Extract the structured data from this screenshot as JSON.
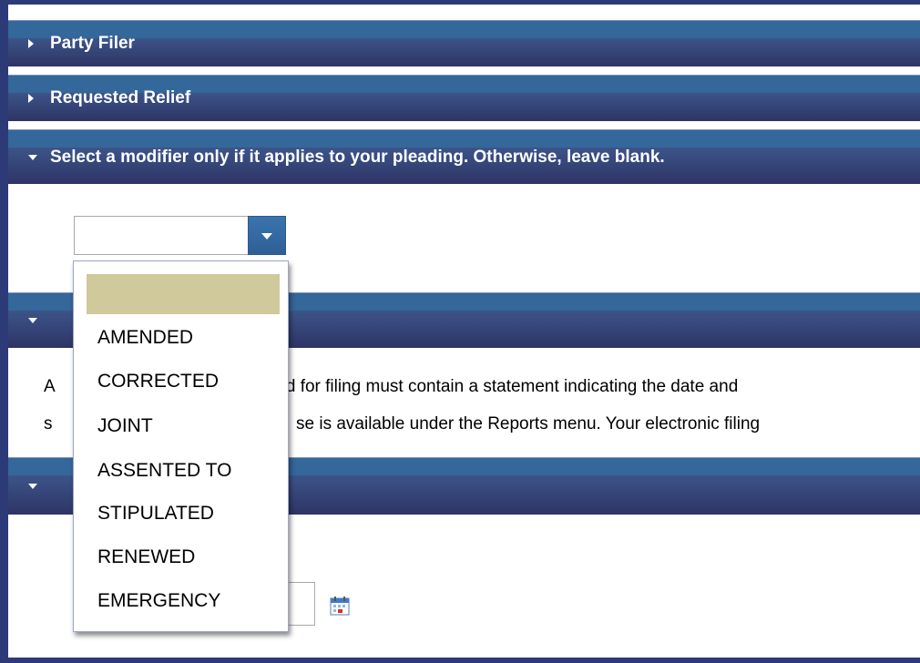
{
  "sections": {
    "party_filer": {
      "title": "Party Filer",
      "state": "collapsed"
    },
    "requested_relief": {
      "title": "Requested Relief",
      "state": "collapsed"
    },
    "modifier": {
      "title": "Select a modifier only if it applies to your pleading. Otherwise, leave blank.",
      "state": "expanded"
    },
    "section4": {
      "state": "expanded"
    },
    "section5": {
      "state": "expanded"
    }
  },
  "modifier_select": {
    "value": "",
    "options": [
      "",
      "AMENDED",
      "CORRECTED",
      "JOINT",
      "ASSENTED TO",
      "STIPULATED",
      "RENEWED",
      "EMERGENCY"
    ]
  },
  "notice": {
    "line1_start": "A",
    "line1_end": "ted for filing must contain a statement indicating the date and",
    "line2_start": "s",
    "line2_end": "se is available under the Reports menu. Your electronic filing"
  },
  "icons": {
    "collapsed": "triangle-right-icon",
    "expanded": "triangle-down-icon",
    "dropdown": "chevron-down-icon",
    "calendar": "calendar-icon"
  },
  "colors": {
    "frame": "#2d3a78",
    "header_top": "#34679a",
    "header_bottom": "#2e3465",
    "selected_option": "#cfc99b"
  }
}
